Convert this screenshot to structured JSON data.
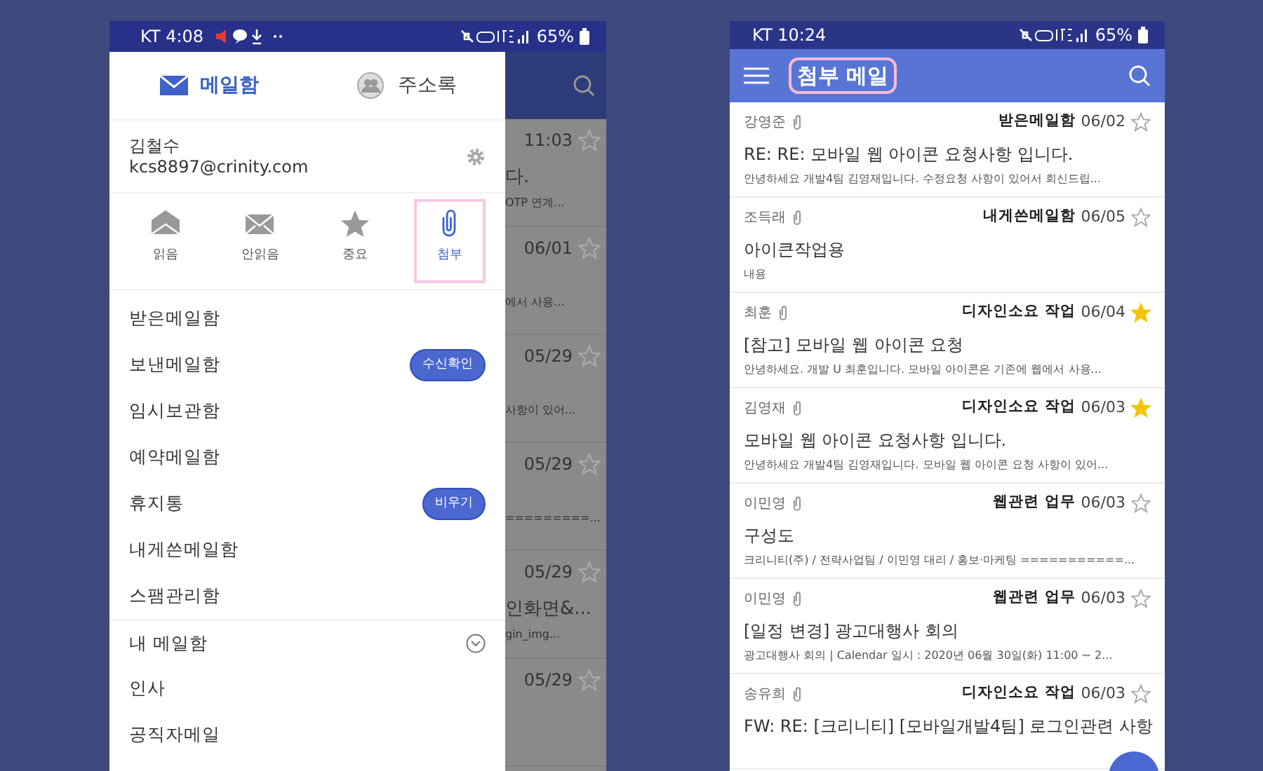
{
  "left_phone": {
    "status_bar": {
      "carrier_time": "KT 4:08",
      "battery": "65%"
    },
    "drawer": {
      "tabs": [
        {
          "label": "메일함",
          "selected": true
        },
        {
          "label": "주소록",
          "selected": false
        }
      ],
      "account": {
        "name": "김철수",
        "email": "kcs8897@crinity.com"
      },
      "filters": [
        {
          "label": "읽음",
          "selected": false
        },
        {
          "label": "안읽음",
          "selected": false
        },
        {
          "label": "중요",
          "selected": false
        },
        {
          "label": "첨부",
          "selected": true
        }
      ],
      "folders": [
        {
          "label": "받은메일함"
        },
        {
          "label": "보낸메일함",
          "badge": "수신확인"
        },
        {
          "label": "임시보관함"
        },
        {
          "label": "예약메일함"
        },
        {
          "label": "휴지통",
          "badge": "비우기"
        },
        {
          "label": "내게쓴메일함"
        },
        {
          "label": "스팸관리함"
        }
      ],
      "my_folders": {
        "label": "내 메일함",
        "expanded": false,
        "children": [
          {
            "label": "인사"
          },
          {
            "label": "공직자메일"
          }
        ]
      }
    },
    "background_list": [
      {
        "date": "11:03",
        "starred": false,
        "subject": "다.",
        "preview": "OTP 연계..."
      },
      {
        "date": "06/01",
        "starred": false,
        "preview": "에서 사용..."
      },
      {
        "date": "05/29",
        "starred": false,
        "preview": "사항이 있어..."
      },
      {
        "date": "05/29",
        "starred": false,
        "preview": "=========..."
      },
      {
        "date": "05/29",
        "starred": false,
        "subject": "인화면&...",
        "preview": "gin_img..."
      },
      {
        "date": "05/29",
        "starred": false
      }
    ]
  },
  "right_phone": {
    "status_bar": {
      "carrier_time": "KT 10:24",
      "battery": "65%"
    },
    "title": "첨부 메일",
    "mails": [
      {
        "sender": "강영준",
        "folder": "받은메일함",
        "date": "06/02",
        "starred": false,
        "subject": "RE: RE: 모바일 웹 아이콘 요청사항 입니다.",
        "preview": "안녕하세요 개발4팀 김영재입니다. 수정요청 사항이 있어서 회신드립..."
      },
      {
        "sender": "조득래",
        "folder": "내게쓴메일함",
        "date": "06/05",
        "starred": false,
        "subject": "아이큰작업용",
        "preview": "내용"
      },
      {
        "sender": "최훈",
        "folder": "디자인소요 작업",
        "date": "06/04",
        "starred": true,
        "subject": "[참고] 모바일 웹 아이콘 요청",
        "preview": "안녕하세요. 개발 U 최훈입니다. 모바일 아이콘은 기존에 웹에서 사용..."
      },
      {
        "sender": "김영재",
        "folder": "디자인소요 작업",
        "date": "06/03",
        "starred": true,
        "subject": "모바일 웹 아이콘 요청사항 입니다.",
        "preview": "안녕하세요 개발4팀 김영재입니다. 모바일 웹 아이콘 요청 사항이 있어..."
      },
      {
        "sender": "이민영",
        "folder": "웹관련 업무",
        "date": "06/03",
        "starred": false,
        "subject": "구성도",
        "preview": "크리니티(주) / 전략사업팀 / 이민영 대리 / 홍보·마케팅 ===========..."
      },
      {
        "sender": "이민영",
        "folder": "웹관련 업무",
        "date": "06/03",
        "starred": false,
        "subject": "[일정 변경] 광고대행사 회의",
        "preview": "광고대행사 회의 | Calendar 일시 : 2020년 06월 30일(화) 11:00 ~ 2..."
      },
      {
        "sender": "송유희",
        "folder": "디자인소요 작업",
        "date": "06/03",
        "starred": false,
        "subject": "FW: RE: [크리니티] [모바일개발4팀] 로그인관련 사항"
      }
    ]
  }
}
